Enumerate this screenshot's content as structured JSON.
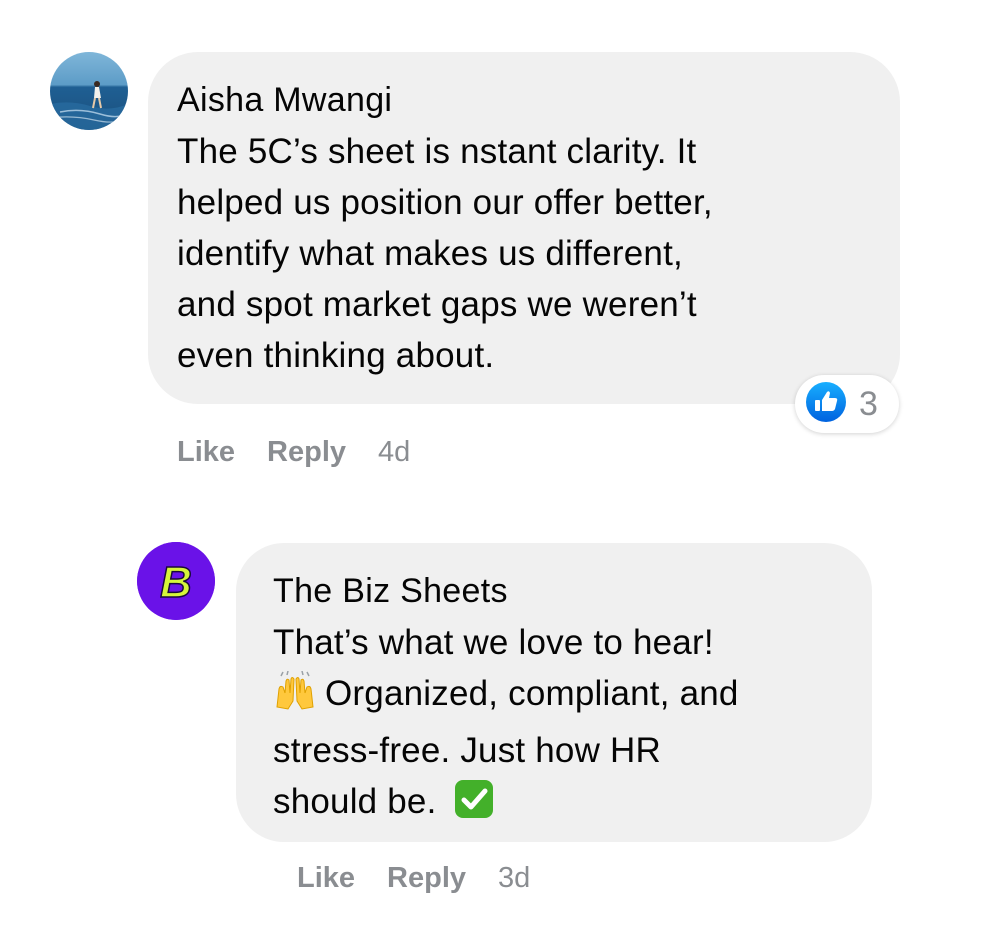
{
  "comment": {
    "author": "Aisha Mwangi",
    "text_lines": [
      "The 5C’s sheet is nstant clarity. It",
      "helped us position our offer better,",
      "identify what makes us different,",
      "and spot market gaps we weren’t",
      "even thinking about."
    ],
    "reaction_icon": "like-thumbs-up-icon",
    "reaction_count": "3",
    "actions": {
      "like": "Like",
      "reply": "Reply",
      "time": "4d"
    }
  },
  "reply": {
    "author": "The Biz Sheets",
    "avatar_letter": "B",
    "text_lines": [
      "That’s what we love to hear!",
      "Organized, compliant, and",
      "stress-free. Just how HR",
      "should be."
    ],
    "emojis": [
      "raising-hands-icon",
      "check-mark-button-icon"
    ],
    "actions": {
      "like": "Like",
      "reply": "Reply",
      "time": "3d"
    }
  },
  "colors": {
    "bubble": "#f0f0f0",
    "meta_text": "#8a8d91",
    "like_blue": "#1877f2",
    "brand_purple": "#6a12e8",
    "brand_yellow": "#d6f53a"
  }
}
